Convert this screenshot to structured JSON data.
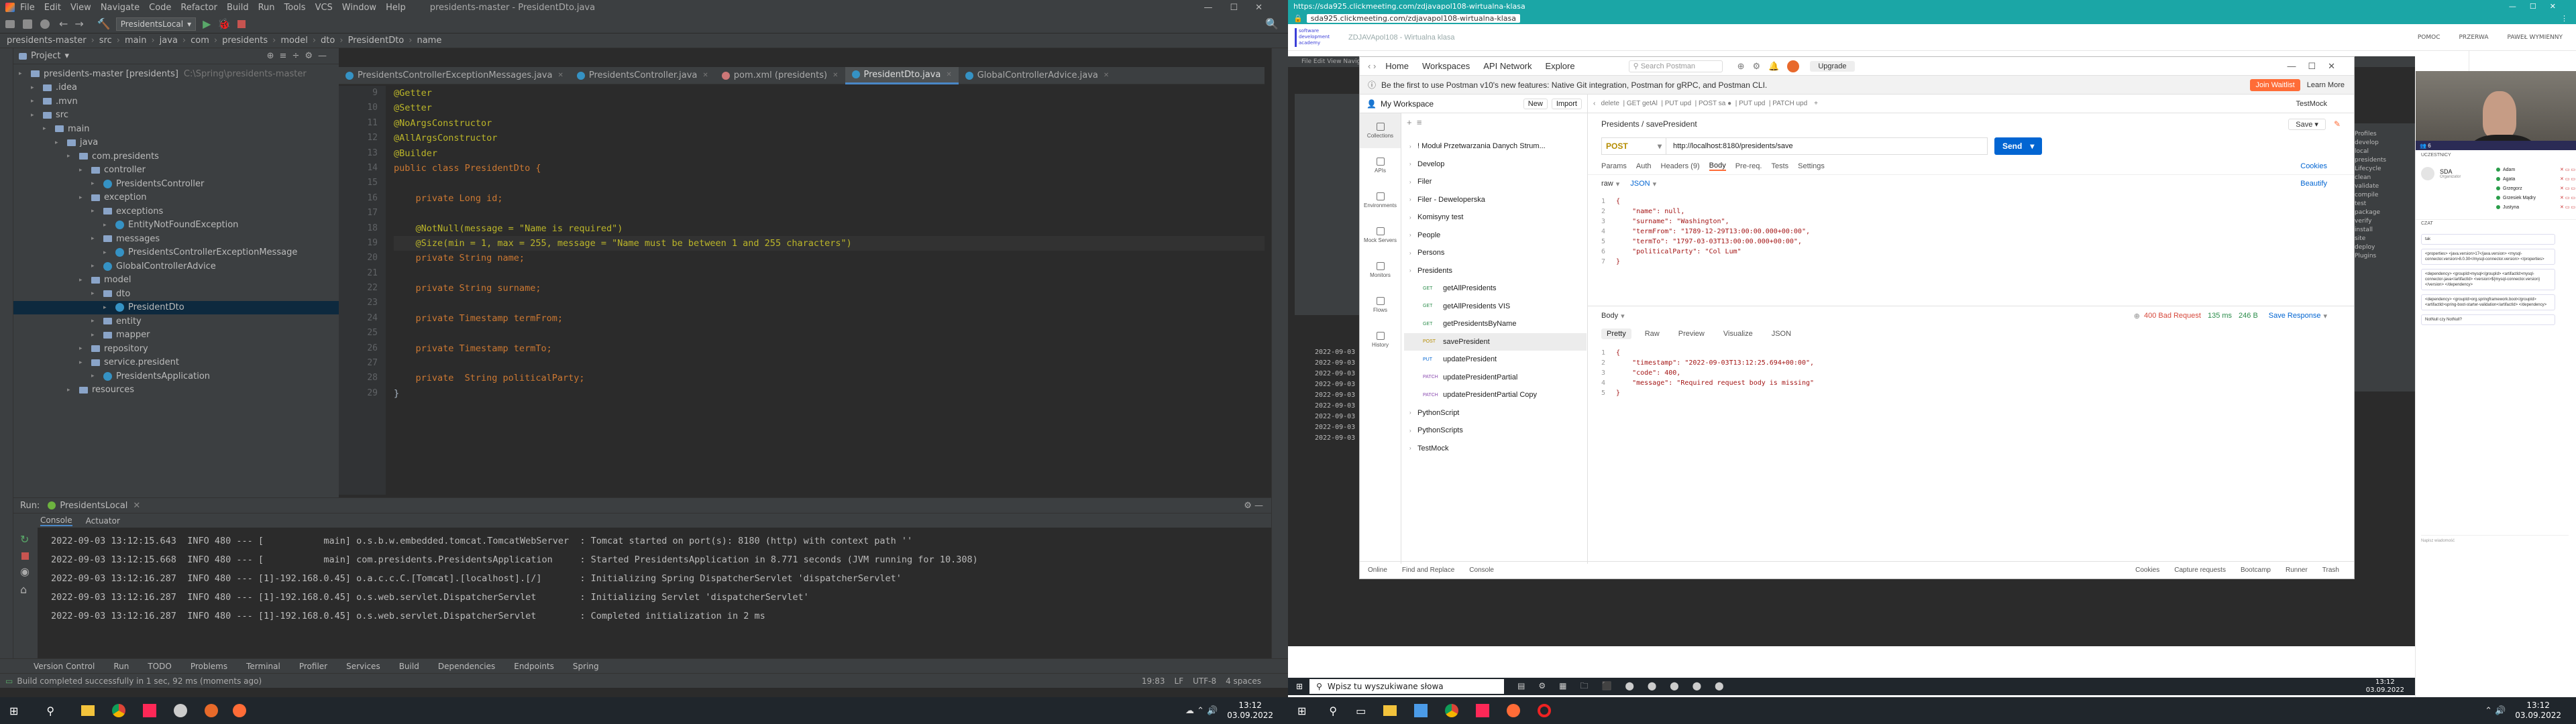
{
  "ide": {
    "menu": [
      "File",
      "Edit",
      "View",
      "Navigate",
      "Code",
      "Refactor",
      "Build",
      "Run",
      "Tools",
      "VCS",
      "Window",
      "Help"
    ],
    "title": "presidents-master - PresidentDto.java",
    "run_config": "PresidentsLocal",
    "breadcrumbs": [
      "presidents-master",
      "src",
      "main",
      "java",
      "com",
      "presidents",
      "model",
      "dto",
      "PresidentDto",
      "name"
    ],
    "project_label": "Project",
    "tabs": [
      "PresidentsControllerExceptionMessages.java",
      "PresidentsController.java",
      "pom.xml (presidents)",
      "PresidentDto.java",
      "GlobalControllerAdvice.java"
    ],
    "tree": [
      {
        "label": "presidents-master [presidents]",
        "extra": "C:\\Spring\\presidents-master",
        "d": 0
      },
      {
        "label": ".idea",
        "d": 1
      },
      {
        "label": ".mvn",
        "d": 1
      },
      {
        "label": "src",
        "d": 1
      },
      {
        "label": "main",
        "d": 2
      },
      {
        "label": "java",
        "d": 3
      },
      {
        "label": "com.presidents",
        "d": 4
      },
      {
        "label": "controller",
        "d": 5
      },
      {
        "label": "PresidentsController",
        "d": 6
      },
      {
        "label": "exception",
        "d": 5
      },
      {
        "label": "exceptions",
        "d": 6
      },
      {
        "label": "EntityNotFoundException",
        "d": 7
      },
      {
        "label": "messages",
        "d": 6
      },
      {
        "label": "PresidentsControllerExceptionMessage",
        "d": 7
      },
      {
        "label": "GlobalControllerAdvice",
        "d": 6
      },
      {
        "label": "model",
        "d": 5
      },
      {
        "label": "dto",
        "d": 6
      },
      {
        "label": "PresidentDto",
        "d": 7,
        "selected": true
      },
      {
        "label": "entity",
        "d": 6
      },
      {
        "label": "mapper",
        "d": 6
      },
      {
        "label": "repository",
        "d": 5
      },
      {
        "label": "service.president",
        "d": 5
      },
      {
        "label": "PresidentsApplication",
        "d": 6
      },
      {
        "label": "resources",
        "d": 4
      }
    ],
    "line_numbers": [
      "9",
      "10",
      "11",
      "12",
      "13",
      "14",
      "15",
      "16",
      "17",
      "18",
      "19",
      "20",
      "21",
      "22",
      "23",
      "24",
      "25",
      "26",
      "27",
      "28",
      "29"
    ],
    "code": [
      "@Getter",
      "@Setter",
      "@NoArgsConstructor",
      "@AllArgsConstructor",
      "@Builder",
      "public class PresidentDto {",
      "",
      "    private Long id;",
      "",
      "    @NotNull(message = \"Name is required\")",
      "    @Size(min = 1, max = 255, message = \"Name must be between 1 and 255 characters\")",
      "    private String name;",
      "",
      "    private String surname;",
      "",
      "    private Timestamp termFrom;",
      "",
      "    private Timestamp termTo;",
      "",
      "    private  String politicalParty;",
      "}"
    ],
    "run_label": "Run:",
    "run_target": "PresidentsLocal",
    "console_tabs": [
      "Console",
      "Actuator"
    ],
    "console": [
      "2022-09-03 13:12:15.643  INFO 480 --- [           main] o.s.b.w.embedded.tomcat.TomcatWebServer  : Tomcat started on port(s): 8180 (http) with context path ''",
      "2022-09-03 13:12:15.668  INFO 480 --- [           main] com.presidents.PresidentsApplication     : Started PresidentsApplication in 8.771 seconds (JVM running for 10.308)",
      "2022-09-03 13:12:16.287  INFO 480 --- [1]-192.168.0.45] o.a.c.c.C.[Tomcat].[localhost].[/]       : Initializing Spring DispatcherServlet 'dispatcherServlet'",
      "2022-09-03 13:12:16.287  INFO 480 --- [1]-192.168.0.45] o.s.web.servlet.DispatcherServlet        : Initializing Servlet 'dispatcherServlet'",
      "2022-09-03 13:12:16.287  INFO 480 --- [1]-192.168.0.45] o.s.web.servlet.DispatcherServlet        : Completed initialization in 2 ms"
    ],
    "bottom_tabs": [
      "Version Control",
      "Run",
      "TODO",
      "Problems",
      "Terminal",
      "Profiler",
      "Services",
      "Build",
      "Dependencies",
      "Endpoints",
      "Spring"
    ],
    "status": "Build completed successfully in 1 sec, 92 ms (moments ago)",
    "status_right": [
      "19:83",
      "LF",
      "UTF-8",
      "4 spaces"
    ]
  },
  "taskbar_left": {
    "time": "13:12",
    "date": "03.09.2022"
  },
  "browser": {
    "tab_url": "https://sda925.clickmeeting.com/zdjavapol108-wirtualna-klasa",
    "address": "sda925.clickmeeting.com/zdjavapol108-wirtualna-klasa",
    "logo": "software development academy",
    "room": "ZDJAVApol108 - Wirtualna klasa",
    "top_right": [
      "POMOC",
      "PRZERWA",
      "PAWEŁ WYMIENNY"
    ],
    "attendees_title": "UCZESTNICY",
    "attendees_count": "6",
    "host_name": "SDA",
    "host_role": "Organizator",
    "attendees": [
      "Adam",
      "Agata",
      "Grzegorz",
      "Grzesiek Mądry",
      "Justyna"
    ],
    "chat_title": "CZAT",
    "chat_msgs": [
      "tak",
      "<properties> <java.version>17</java.version> <mysql-connector.version>8.0.30</mysql-connector.version> </properties>",
      "<dependency> <groupId>mysql</groupId> <artifactId>mysql-connector-java</artifactId> <version>${mysql-connector.version}</version> </dependency>",
      "<dependency> <groupId>org.springframework.boot</groupId> <artifactId>spring-boot-starter-validation</artifactId> </dependency>",
      "NotNull czy NotNull?"
    ],
    "chat_placeholder": "Napisz wiadomość"
  },
  "postman": {
    "menu": [
      "Home",
      "Workspaces",
      "API Network",
      "Explore"
    ],
    "search": "Search Postman",
    "upgrade": "Upgrade",
    "banner": "Be the first to use Postman v10's new features: Native Git integration, Postman for gRPC, and Postman CLI.",
    "banner_btn1": "Join Waitlist",
    "banner_btn2": "Learn More",
    "workspace": "My Workspace",
    "new_btn": "New",
    "import_btn": "Import",
    "sidebar_icons": [
      "Collections",
      "APIs",
      "Environments",
      "Mock Servers",
      "Monitors",
      "Flows",
      "History"
    ],
    "collections": [
      {
        "label": "! Moduł Przetwarzania Danych Strum...",
        "d": 0
      },
      {
        "label": "Develop",
        "d": 0
      },
      {
        "label": "Filer",
        "d": 0
      },
      {
        "label": "Filer - Deweloperska",
        "d": 0
      },
      {
        "label": "Komisyny test",
        "d": 0
      },
      {
        "label": "People",
        "d": 0
      },
      {
        "label": "Persons",
        "d": 0
      },
      {
        "label": "Presidents",
        "d": 0
      },
      {
        "m": "GET",
        "label": "getAllPresidents",
        "d": 1
      },
      {
        "m": "GET",
        "label": "getAllPresidents VIS",
        "d": 1
      },
      {
        "m": "GET",
        "label": "getPresidentsByName",
        "d": 1
      },
      {
        "m": "POST",
        "label": "savePresident",
        "d": 1,
        "selected": true
      },
      {
        "m": "PUT",
        "label": "updatePresident",
        "d": 1
      },
      {
        "m": "PATCH",
        "label": "updatePresidentPartial",
        "d": 1
      },
      {
        "m": "PATCH",
        "label": "updatePresidentPartial Copy",
        "d": 1
      },
      {
        "label": "PythonScript",
        "d": 0
      },
      {
        "label": "PythonScripts",
        "d": 0
      },
      {
        "label": "TestMock",
        "d": 0
      }
    ],
    "env": "TestMock",
    "crumb": "Presidents / savePresident",
    "save": "Save",
    "method": "POST",
    "url": "http://localhost:8180/presidents/save",
    "send": "Send",
    "req_tabs": [
      "Params",
      "Auth",
      "Headers (9)",
      "Body",
      "Pre-req.",
      "Tests",
      "Settings"
    ],
    "cookies": "Cookies",
    "beautify": "Beautify",
    "body_mode": "raw",
    "body_type": "JSON",
    "req_body": [
      "{",
      "    \"name\": null,",
      "    \"surname\": \"Washington\",",
      "    \"termFrom\": \"1789-12-29T13:00:00.000+00:00\",",
      "    \"termTo\": \"1797-03-03T13:00:00.000+00:00\",",
      "    \"politicalParty\": \"Col Lum\"",
      "}"
    ],
    "resp_label": "Body",
    "status": "400 Bad Request",
    "time": "135 ms",
    "size": "246 B",
    "save_resp": "Save Response",
    "resp_tabs": [
      "Pretty",
      "Raw",
      "Preview",
      "Visualize",
      "JSON"
    ],
    "resp_body": [
      "{",
      "    \"timestamp\": \"2022-09-03T13:12:25.694+00:00\",",
      "    \"code\": 400,",
      "    \"message\": \"Required request body is missing\"",
      "}"
    ],
    "footer": [
      "Online",
      "Find and Replace",
      "Console",
      "Cookies",
      "Capture requests",
      "Bootcamp",
      "Runner",
      "Trash"
    ]
  },
  "taskbar_right": {
    "search": "Wpisz tu wyszukiwane słowa",
    "time": "13:12",
    "date": "03.09.2022"
  }
}
